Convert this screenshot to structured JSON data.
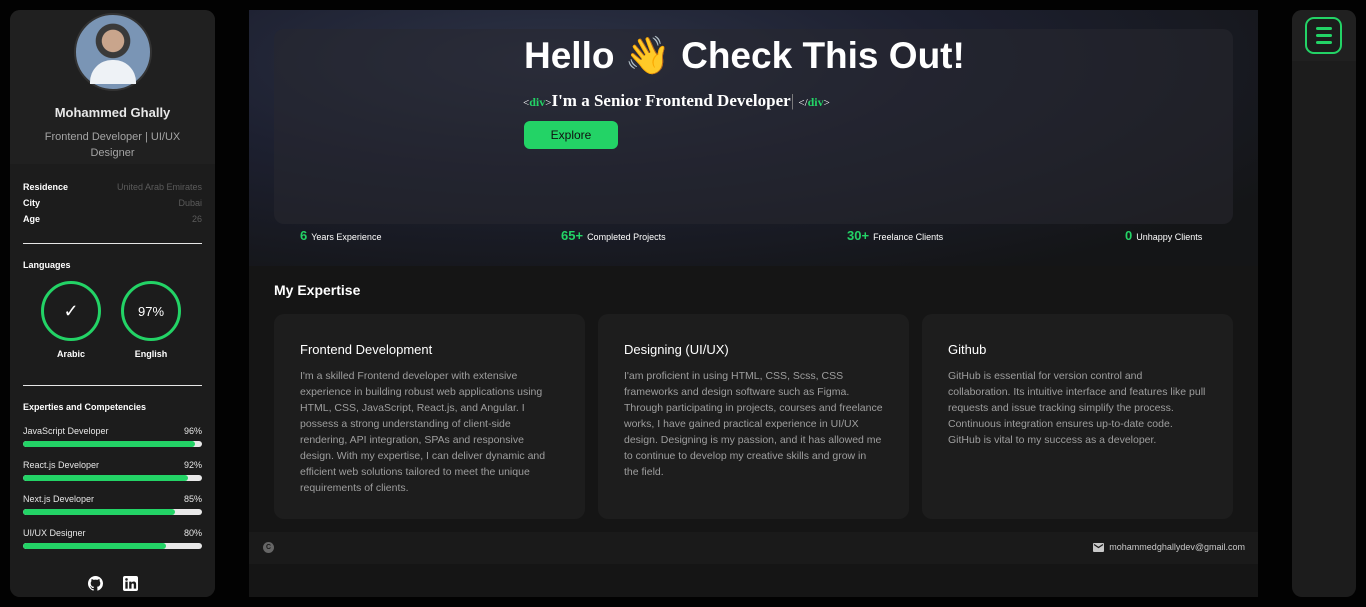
{
  "colors": {
    "accent": "#23d366",
    "background": "#020202",
    "panel": "#1c1c1c"
  },
  "profile": {
    "name": "Mohammed Ghally",
    "role": "Frontend Developer | UI/UX Designer",
    "info": [
      {
        "key": "Residence",
        "value": "United Arab Emirates"
      },
      {
        "key": "City",
        "value": "Dubai"
      },
      {
        "key": "Age",
        "value": "26"
      }
    ]
  },
  "languages": {
    "title": "Languages",
    "items": [
      {
        "name": "Arabic",
        "display": "✓",
        "percent": 100
      },
      {
        "name": "English",
        "display": "97%",
        "percent": 97
      }
    ]
  },
  "skills": {
    "title": "Experties and Competencies",
    "items": [
      {
        "name": "JavaScript Developer",
        "label": "96%",
        "percent": 96
      },
      {
        "name": "React.js Developer",
        "label": "92%",
        "percent": 92
      },
      {
        "name": "Next.js Developer",
        "label": "85%",
        "percent": 85
      },
      {
        "name": "UI/UX Designer",
        "label": "80%",
        "percent": 80
      }
    ]
  },
  "socials": [
    "github-icon",
    "linkedin-icon"
  ],
  "hero": {
    "title_start": "Hello",
    "title_emoji": "👋",
    "title_end": "Check This Out!",
    "tag_open_left": "<",
    "tag_name": "div",
    "tag_open_right": ">",
    "subtitle": "I'm a Senior Frontend Developer",
    "caret": "|",
    "tag_close_left": "</",
    "tag_close_right": ">",
    "button": "Explore"
  },
  "stats": [
    {
      "num": "6",
      "label": "Years Experience"
    },
    {
      "num": "65+",
      "label": "Completed Projects"
    },
    {
      "num": "30+",
      "label": "Freelance Clients"
    },
    {
      "num": "0",
      "label": "Unhappy Clients"
    }
  ],
  "expertise": {
    "title": "My Expertise",
    "cards": [
      {
        "title": "Frontend Development",
        "text": "I'm a skilled Frontend developer with extensive experience in building robust web applications using HTML, CSS, JavaScript, React.js, and Angular. I possess a strong understanding of client-side rendering, API integration, SPAs and responsive design. With my expertise, I can deliver dynamic and efficient web solutions tailored to meet the unique requirements of clients."
      },
      {
        "title": "Designing (UI/UX)",
        "text": "I'am proficient in using HTML, CSS, Scss, CSS frameworks and design software such as Figma. Through participating in projects, courses and freelance works, I have gained practical experience in UI/UX design. Designing is my passion, and it has allowed me to continue to develop my creative skills and grow in the field."
      },
      {
        "title": "Github",
        "text": "GitHub is essential for version control and collaboration. Its intuitive interface and features like pull requests and issue tracking simplify the process. Continuous integration ensures up-to-date code. GitHub is vital to my success as a developer."
      }
    ]
  },
  "footer": {
    "copyright_icon": "C",
    "email": "mohammedghallydev@gmail.com"
  }
}
